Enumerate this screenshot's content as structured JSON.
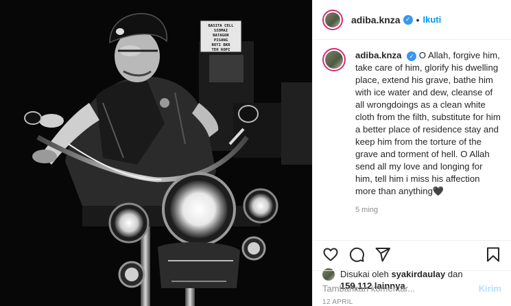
{
  "header": {
    "username": "adiba.knza",
    "verified_icon": "verified-badge-icon",
    "separator": "•",
    "follow_label": "Ikuti"
  },
  "caption": {
    "username": "adiba.knza",
    "text": "O Allah, forgive him, take care of him, glorify his dwelling place, extend his grave, bathe him with ice water and dew, cleanse of all wrongdoings as a clean white cloth from the filth, substitute for him a better place of residence stay and keep him from the torture of the grave and torment of hell. O Allah send all my love and longing for him, tell him i miss his affection more than anything",
    "emoji": "🖤",
    "time_ago": "5 ming"
  },
  "photo": {
    "shop_sign_lines": [
      "BASITA CELL",
      "SIOMAI",
      "BATAGOR",
      "PISANG",
      "ROTI BKR",
      "TEH KOPI"
    ]
  },
  "actions": {
    "like_icon": "heart-icon",
    "comment_icon": "comment-icon",
    "share_icon": "paper-plane-icon",
    "save_icon": "bookmark-icon"
  },
  "likes": {
    "prefix": "Disukai oleh",
    "liker": "syakirdaulay",
    "and": "dan",
    "count": "159,112",
    "suffix": "lainnya"
  },
  "date": "12 APRIL",
  "comment_box": {
    "placeholder": "Tambahkan komentar...",
    "post_label": "Kirim"
  },
  "colors": {
    "link_blue": "#0095f6",
    "verified_blue": "#3897f0",
    "post_disabled": "#b2dffc",
    "muted_text": "#8e8e8e",
    "avatar_ring": "#d62976"
  }
}
